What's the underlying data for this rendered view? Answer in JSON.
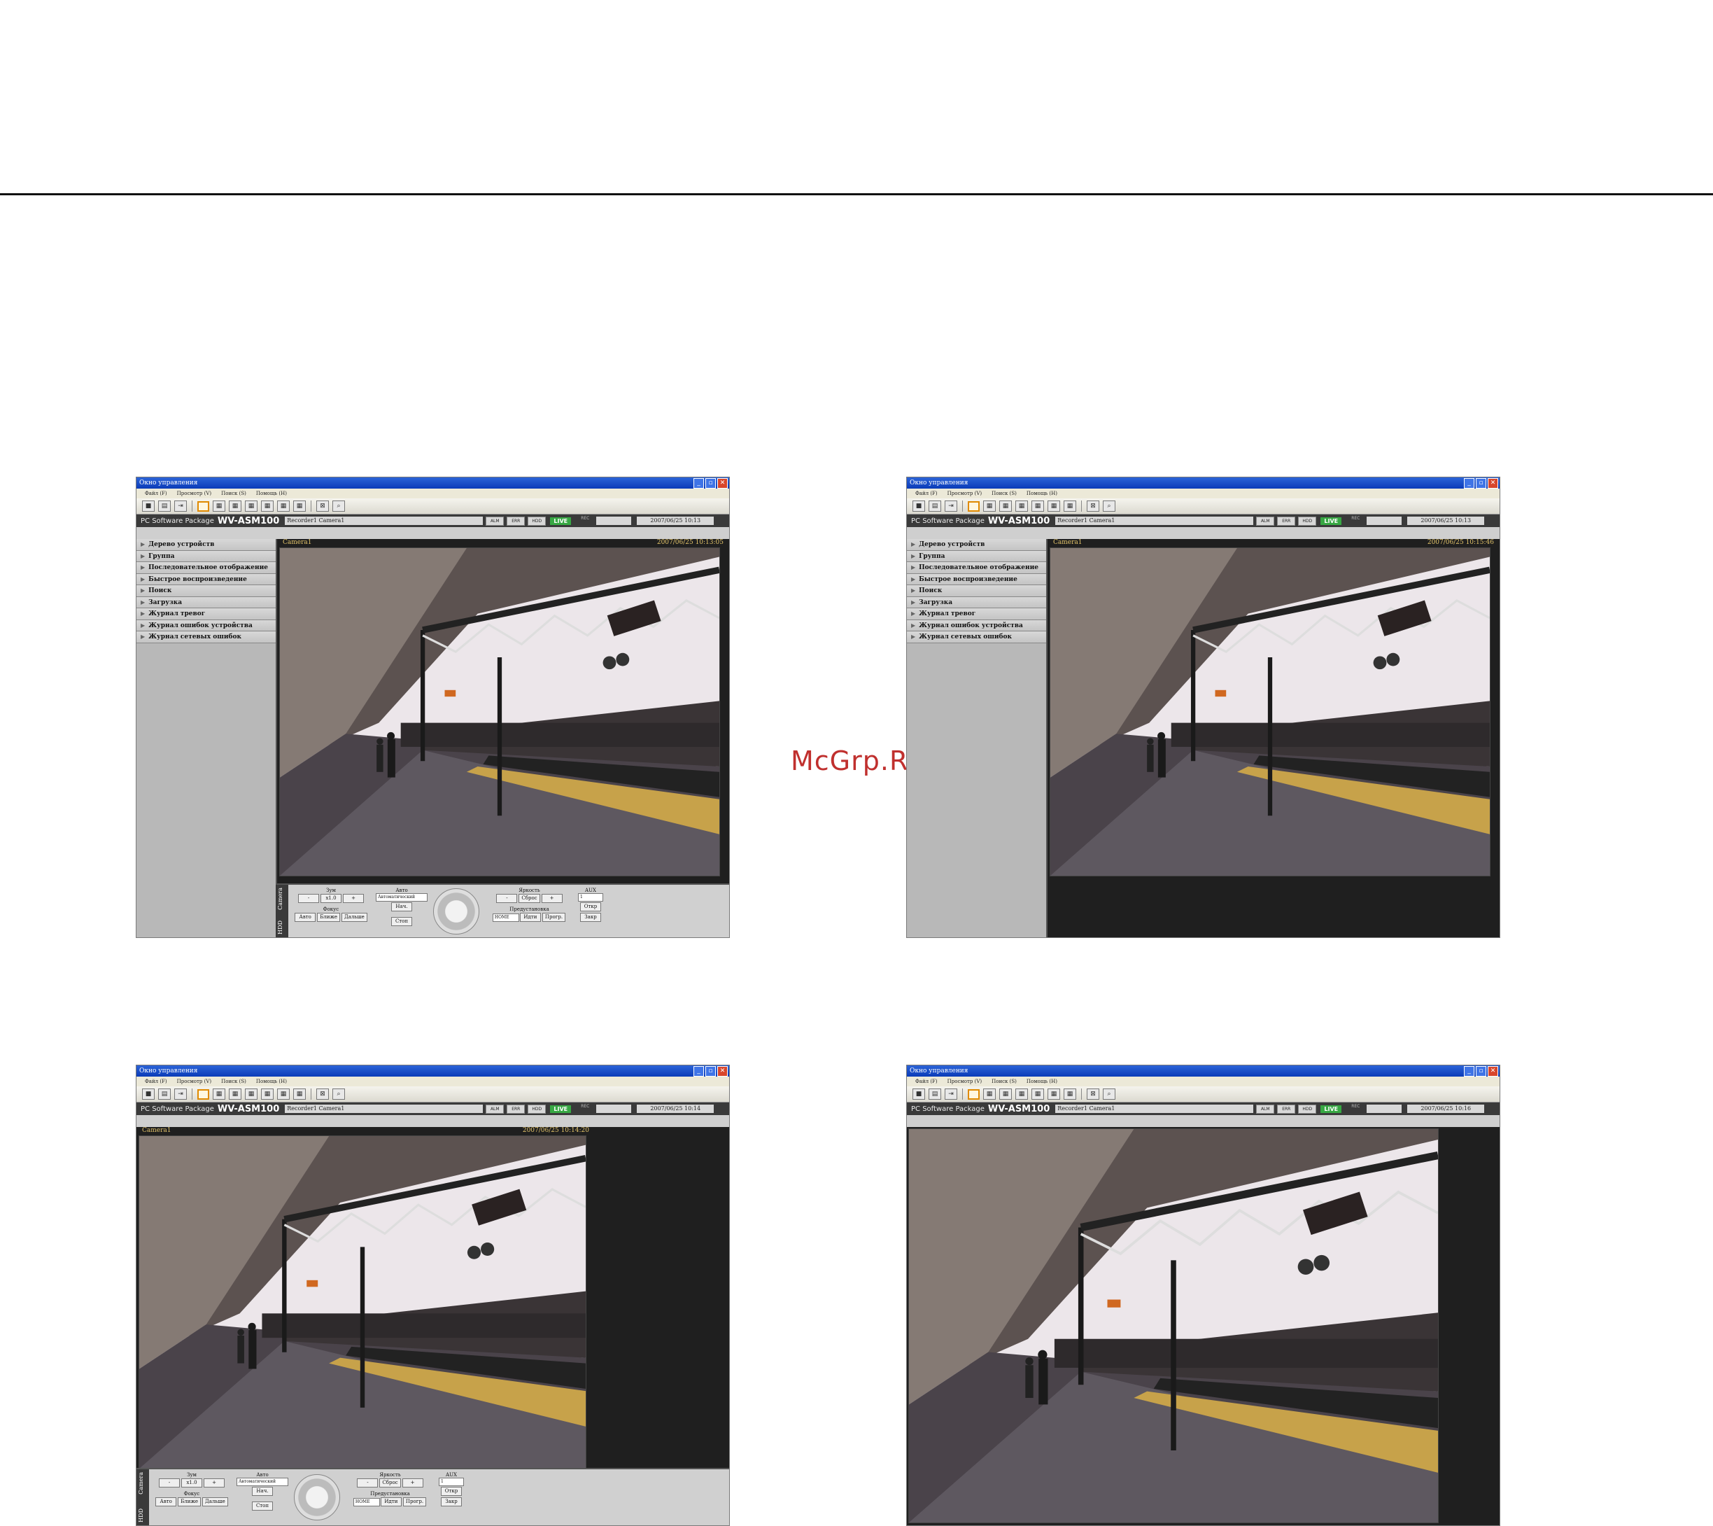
{
  "watermark": "McGrp.Ru",
  "window": {
    "title": "Окно управления",
    "menu": [
      "Файл (F)",
      "Просмотр (V)",
      "Поиск (S)",
      "Помощь (H)"
    ],
    "win_buttons": [
      "_",
      "▫",
      "✕"
    ],
    "toolbar_icons": [
      "camera-icon",
      "print-icon",
      "exit-icon",
      "layout-1-icon",
      "layout-4-icon",
      "layout-7-icon",
      "layout-9-icon",
      "layout-10-icon",
      "layout-13-icon",
      "layout-16-icon",
      "fullscreen-icon",
      "zoom-icon"
    ]
  },
  "header": {
    "package": "PC Software Package",
    "model": "WV-ASM100",
    "recorder": "Recorder1 Camera1",
    "btn_alm": "ALM",
    "btn_err": "ERR",
    "btn_hdd": "HDD",
    "live": "LIVE",
    "rec": "REC"
  },
  "sidebar": {
    "items": [
      "Дерево устройств",
      "Группа",
      "Последовательное отображение",
      "Быстрое воспроизведение",
      "Поиск",
      "Загрузка",
      "Журнал тревог",
      "Журнал ошибок устройства",
      "Журнал сетевых ошибок"
    ]
  },
  "camera_label": "Camera1",
  "screens": [
    {
      "datetime": "2007/06/25 10:13",
      "overlay_ts": "2007/06/25 10:13:05"
    },
    {
      "datetime": "2007/06/25 10:13",
      "overlay_ts": "2007/06/25 10:15:46"
    },
    {
      "datetime": "2007/06/25 10:14",
      "overlay_ts": "2007/06/25 10:14:20"
    },
    {
      "datetime": "2007/06/25 10:16",
      "overlay_ts": ""
    }
  ],
  "controls": {
    "tab_camera": "Camera",
    "tab_hdd": "HDD",
    "zoom": "Зум",
    "zoom_minus": "-",
    "zoom_value": "x1.0",
    "zoom_plus": "+",
    "focus": "Фокус",
    "focus_auto": "Авто",
    "focus_near": "Ближе",
    "focus_far": "Дальше",
    "auto": "Авто",
    "auto_select": "Автоматический",
    "auto_start": "Нач.",
    "auto_stop": "Стоп",
    "brightness": "Яркость",
    "bright_minus": "-",
    "bright_reset": "Сброс",
    "bright_plus": "+",
    "preset": "Предустановка",
    "preset_select": "HOME",
    "preset_go": "Идти",
    "preset_prog": "Прогр.",
    "aux": "AUX",
    "aux_select": "1",
    "aux_open": "Откр",
    "aux_close": "Закр"
  }
}
